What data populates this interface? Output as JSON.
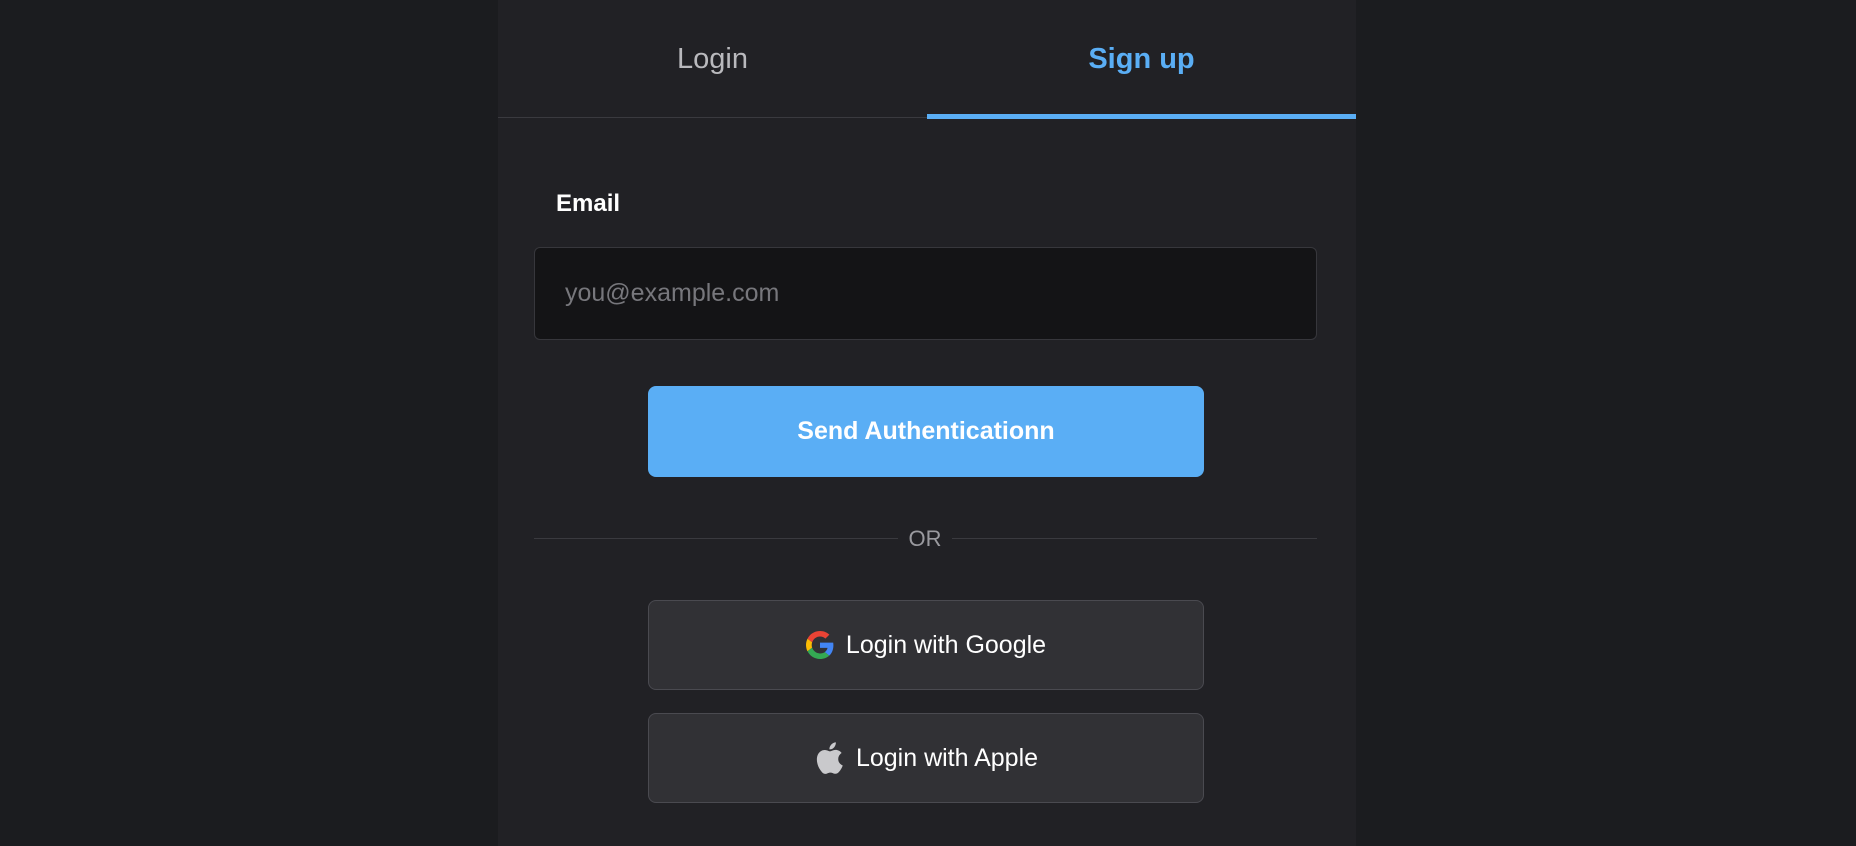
{
  "tabs": {
    "login_label": "Login",
    "signup_label": "Sign up",
    "active": "signup"
  },
  "form": {
    "email_label": "Email",
    "email_placeholder": "you@example.com",
    "email_value": "",
    "send_button_label": "Send Authenticationn"
  },
  "divider": {
    "label": "OR"
  },
  "social": {
    "google_label": "Login with Google",
    "google_icon": "google-icon",
    "apple_label": "Login with Apple",
    "apple_icon": "apple-icon"
  },
  "colors": {
    "background": "#1b1c1f",
    "panel": "#212125",
    "accent": "#5aaef5",
    "input_background": "#141416",
    "social_button_background": "#313135"
  }
}
